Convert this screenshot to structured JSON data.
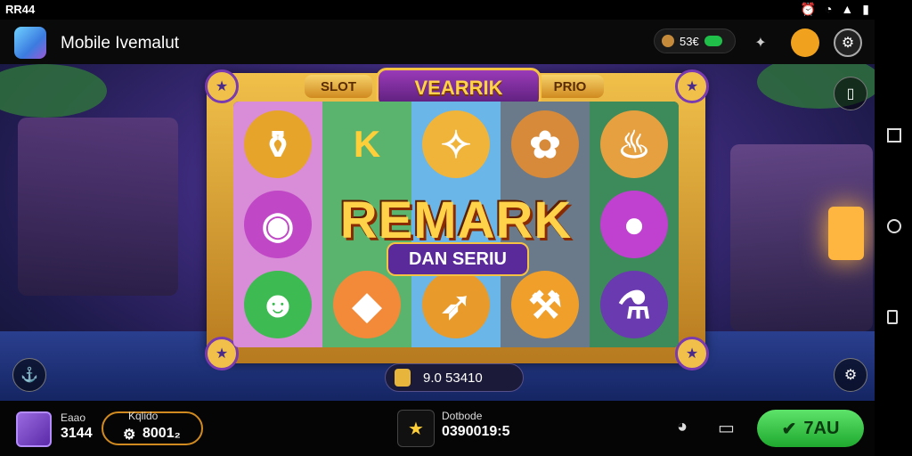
{
  "status": {
    "time": "RR44",
    "icons": [
      "alarm-icon",
      "wifi-icon",
      "signal-icon",
      "battery-icon"
    ]
  },
  "app_bar": {
    "title": "Mobile Ivemalut",
    "coin_value": "53€"
  },
  "game": {
    "banner": "VEARRIK",
    "left_label": "SLOT",
    "right_label": "PRIO",
    "headline": "REMARK",
    "subhead": "DAN SERIU",
    "win_value": "9.0 53410",
    "reels": [
      [
        "potion-icon",
        "bell-icon",
        "dragon-icon"
      ],
      [
        "k-icon",
        "sword-icon",
        "gem-icon"
      ],
      [
        "scroll-icon",
        "bell-icon",
        "rocket-icon"
      ],
      [
        "fruit-icon",
        "hammer-icon",
        "gem-icon"
      ],
      [
        "horn-icon",
        "orb-icon",
        "potion-icon"
      ]
    ]
  },
  "bottom": {
    "left_label": "Eaao",
    "left_value": "3144",
    "balance_label": "Kqlido",
    "balance_value": "8001₂",
    "center_label": "Dotbode",
    "center_value": "0390019:5",
    "play_label": "7AU"
  },
  "colors": {
    "accent": "#f5c242",
    "play": "#1fa92f",
    "frame": "#f0c04a"
  }
}
